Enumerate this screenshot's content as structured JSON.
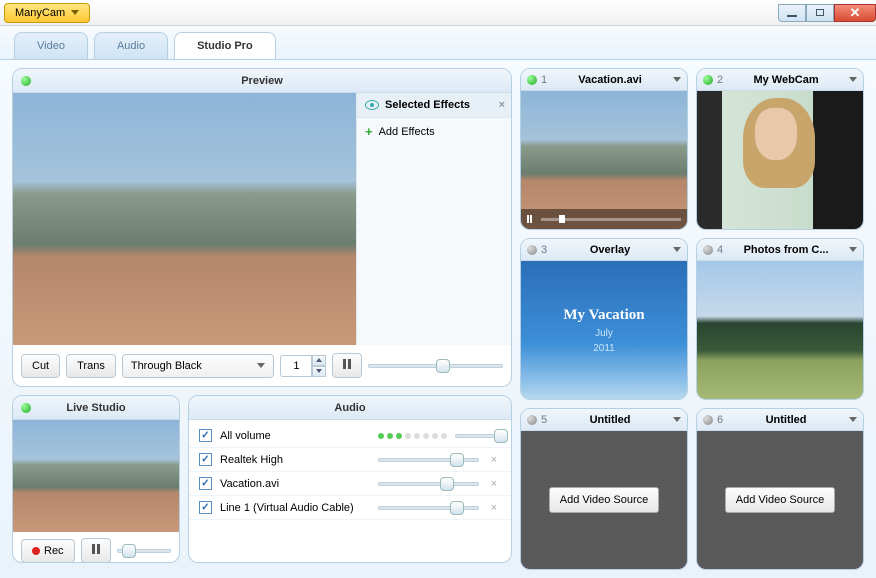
{
  "app": {
    "name": "ManyCam"
  },
  "tabs": [
    {
      "label": "Video",
      "active": false
    },
    {
      "label": "Audio",
      "active": false
    },
    {
      "label": "Studio Pro",
      "active": true
    }
  ],
  "preview": {
    "title": "Preview",
    "effects_title": "Selected Effects",
    "add_effects": "Add Effects",
    "cut": "Cut",
    "trans": "Trans",
    "transition_mode": "Through Black",
    "duration": "1"
  },
  "livestudio": {
    "title": "Live Studio",
    "rec": "Rec"
  },
  "audio": {
    "title": "Audio",
    "rows": [
      {
        "label": "All volume",
        "hasDots": true
      },
      {
        "label": "Realtek High"
      },
      {
        "label": "Vacation.avi"
      },
      {
        "label": "Line 1 (Virtual Audio Cable)"
      }
    ]
  },
  "sources": [
    {
      "num": "1",
      "title": "Vacation.avi",
      "kind": "video",
      "active": true
    },
    {
      "num": "2",
      "title": "My WebCam",
      "kind": "webcam",
      "active": true
    },
    {
      "num": "3",
      "title": "Overlay",
      "kind": "overlay",
      "active": false,
      "overlay": {
        "line1": "My Vacation",
        "line2": "July",
        "line3": "2011"
      }
    },
    {
      "num": "4",
      "title": "Photos from C...",
      "kind": "photos",
      "active": false
    },
    {
      "num": "5",
      "title": "Untitled",
      "kind": "empty",
      "active": false
    },
    {
      "num": "6",
      "title": "Untitled",
      "kind": "empty",
      "active": false
    }
  ],
  "add_video_source": "Add Video Source"
}
